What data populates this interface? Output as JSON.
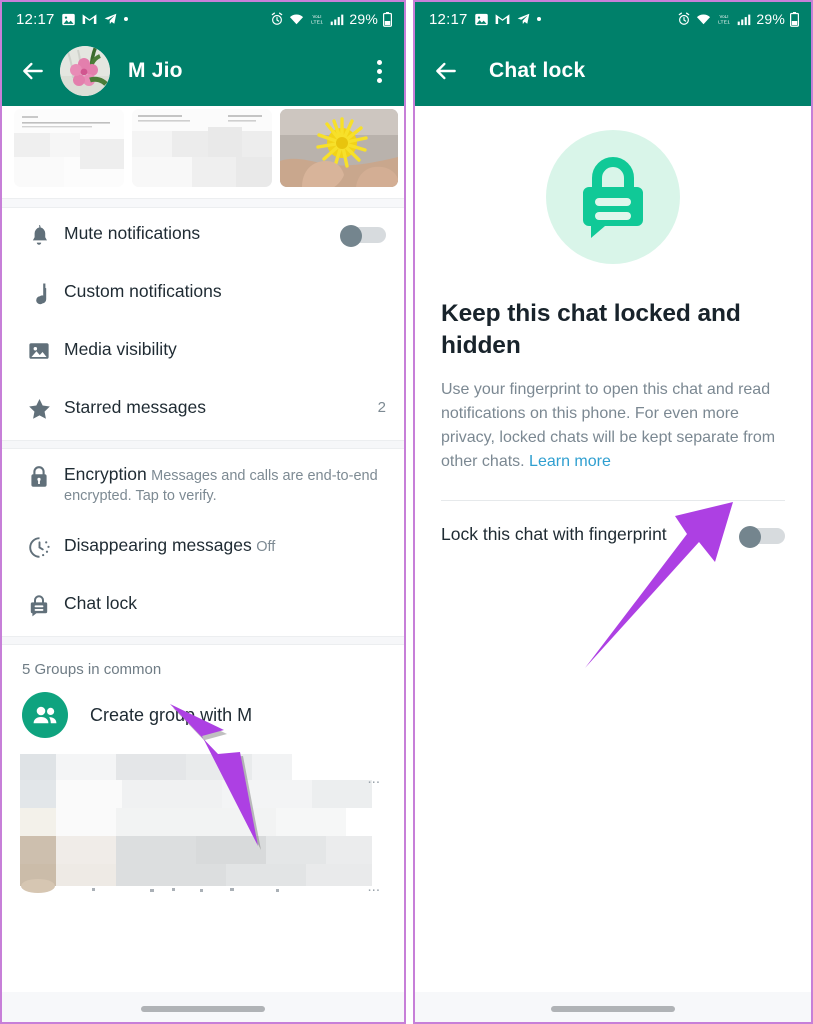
{
  "panels": {
    "left": {
      "status_bar": {
        "time": "12:17",
        "icons": [
          "image-icon",
          "gmail-icon",
          "telegram-icon",
          "dot-icon"
        ],
        "right_icons": [
          "alarm-icon",
          "wifi-icon",
          "volte-icon",
          "signal-icon"
        ],
        "battery": "29%"
      },
      "app_bar": {
        "back": "back-arrow-icon",
        "title": "M Jio",
        "menu": "overflow-menu-icon"
      },
      "settings": [
        {
          "icon": "bell-icon",
          "title": "Mute notifications",
          "sub": "",
          "trail": "",
          "toggle": "off"
        },
        {
          "icon": "music-note-icon",
          "title": "Custom notifications",
          "sub": "",
          "trail": ""
        },
        {
          "icon": "photo-icon",
          "title": "Media visibility",
          "sub": "",
          "trail": ""
        },
        {
          "icon": "star-icon",
          "title": "Starred messages",
          "sub": "",
          "trail": "2"
        }
      ],
      "privacy": [
        {
          "icon": "lock-icon",
          "title": "Encryption",
          "sub": "Messages and calls are end-to-end encrypted. Tap to verify."
        },
        {
          "icon": "timer-icon",
          "title": "Disappearing messages",
          "sub": "Off"
        },
        {
          "icon": "chat-lock-icon",
          "title": "Chat lock",
          "sub": ""
        }
      ],
      "groups": {
        "header": "5 Groups in common",
        "create_label": "Create group with M",
        "create_icon": "people-icon",
        "blurred_rows": [
          "",
          "",
          ""
        ],
        "ellipsis": "..."
      }
    },
    "right": {
      "status_bar": {
        "time": "12:17",
        "icons": [
          "image-icon",
          "gmail-icon",
          "telegram-icon",
          "dot-icon"
        ],
        "right_icons": [
          "alarm-icon",
          "wifi-icon",
          "volte-icon",
          "signal-icon"
        ],
        "battery": "29%"
      },
      "app_bar": {
        "back": "back-arrow-icon",
        "title": "Chat lock"
      },
      "hero": {
        "icon": "chat-lock-badge-icon",
        "title": "Keep this chat locked and hidden",
        "body": "Use your fingerprint to open this chat and read notifications on this phone. For even more privacy, locked chats will be kept separate from other chats. ",
        "link": "Learn more"
      },
      "lock_setting": {
        "label": "Lock this chat with fingerprint",
        "toggle": "off"
      }
    }
  },
  "annotations": {
    "arrow_left": "purple-arrow-pointing-to-chat-lock",
    "arrow_right": "purple-arrow-pointing-to-fingerprint-toggle"
  },
  "colors": {
    "header_green": "#00806a",
    "accent_green": "#0fa37f",
    "hero_bg": "#d9f5e9",
    "hero_icon": "#10c997",
    "link_blue": "#2f9fd0",
    "arrow_purple": "#ad40e3",
    "panel_border": "#c77fd8"
  }
}
